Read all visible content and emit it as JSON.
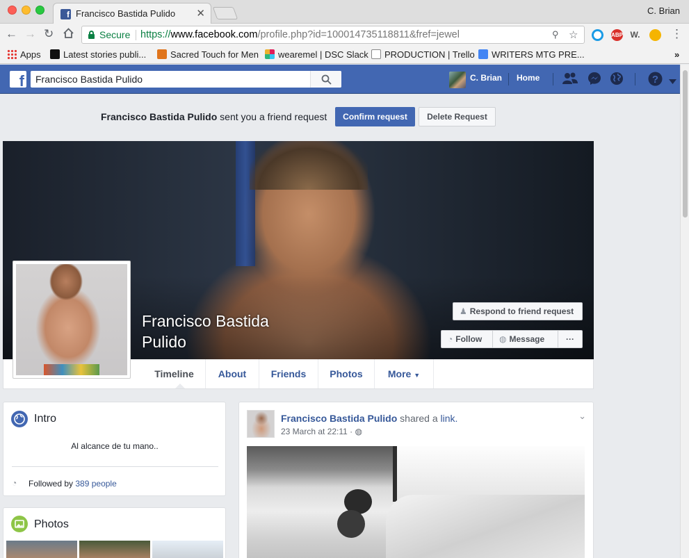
{
  "browser": {
    "tab_title": "Francisco Bastida Pulido",
    "profile_name": "C. Brian",
    "secure_label": "Secure",
    "url_scheme": "https://",
    "url_host": "www.facebook.com",
    "url_path": "/profile.php?id=100014735118811&fref=jewel",
    "bookmarks": [
      {
        "label": "Apps"
      },
      {
        "label": "Latest stories publi..."
      },
      {
        "label": "Sacred Touch for Men"
      },
      {
        "label": "wearemel | DSC Slack"
      },
      {
        "label": "PRODUCTION | Trello"
      },
      {
        "label": "WRITERS MTG PRE..."
      }
    ],
    "extensions": [
      "ABP",
      "W."
    ],
    "overflow": "»"
  },
  "fb": {
    "logo": "f",
    "search_value": "Francisco Bastida Pulido",
    "user_name": "C. Brian",
    "home_label": "Home"
  },
  "friend_request": {
    "name": "Francisco Bastida Pulido",
    "text": " sent you a friend request",
    "confirm_label": "Confirm request",
    "delete_label": "Delete Request"
  },
  "profile": {
    "name": "Francisco Bastida Pulido",
    "respond_label": "Respond to friend request",
    "follow_label": "Follow",
    "message_label": "Message",
    "more_dots": "···",
    "tabs": [
      "Timeline",
      "About",
      "Friends",
      "Photos",
      "More"
    ]
  },
  "intro": {
    "title": "Intro",
    "bio": "Al alcance de tu mano..",
    "followed_prefix": "Followed by ",
    "followed_link": "389 people"
  },
  "photos": {
    "title": "Photos"
  },
  "post": {
    "author": "Francisco Bastida Pulido",
    "action": " shared a ",
    "link_word": "link.",
    "timestamp": "23 March at 22:11 · "
  },
  "colors": {
    "fb_blue": "#4267b2",
    "link_blue": "#365899",
    "page_bg": "#e9ebee"
  }
}
